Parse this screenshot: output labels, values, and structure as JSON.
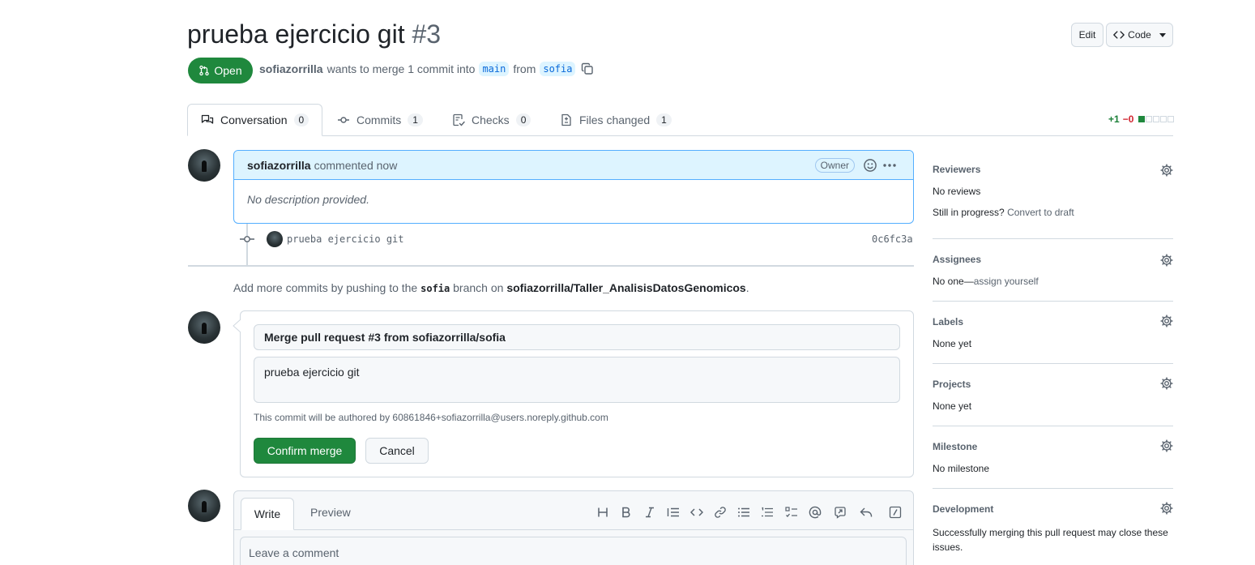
{
  "pr": {
    "title": "prueba ejercicio git",
    "number": "#3",
    "state": "Open",
    "author": "sofiazorrilla",
    "merge_text": "wants to merge 1 commit into",
    "base_branch": "main",
    "from_text": "from",
    "head_branch": "sofia"
  },
  "header_buttons": {
    "edit": "Edit",
    "code": "Code"
  },
  "tabs": [
    {
      "label": "Conversation",
      "count": "0"
    },
    {
      "label": "Commits",
      "count": "1"
    },
    {
      "label": "Checks",
      "count": "0"
    },
    {
      "label": "Files changed",
      "count": "1"
    }
  ],
  "diffstat": {
    "additions": "+1",
    "deletions": "−0"
  },
  "comment": {
    "author": "sofiazorrilla",
    "action": "commented now",
    "badge": "Owner",
    "body": "No description provided."
  },
  "commit": {
    "message": "prueba ejercicio git",
    "sha": "0c6fc3a"
  },
  "hint": {
    "prefix": "Add more commits by pushing to the",
    "branch": "sofia",
    "middle": "branch on",
    "repo": "sofiazorrilla/Taller_AnalisisDatosGenomicos",
    "suffix": "."
  },
  "merge": {
    "title_value": "Merge pull request #3 from sofiazorrilla/sofia",
    "body_value": "prueba ejercicio git",
    "author_note": "This commit will be authored by 60861846+sofiazorrilla@users.noreply.github.com",
    "confirm_label": "Confirm merge",
    "cancel_label": "Cancel"
  },
  "editor": {
    "write_tab": "Write",
    "preview_tab": "Preview",
    "placeholder": "Leave a comment",
    "toolbar": [
      "heading-icon",
      "bold-icon",
      "italic-icon",
      "quote-icon",
      "code-icon",
      "link-icon",
      "unordered-list-icon",
      "ordered-list-icon",
      "task-list-icon",
      "mention-icon",
      "reference-icon",
      "reply-icon",
      "slash-command-icon"
    ]
  },
  "sidebar": {
    "reviewers": {
      "title": "Reviewers",
      "value": "No reviews",
      "progress_text": "Still in progress?",
      "draft_link": "Convert to draft"
    },
    "assignees": {
      "title": "Assignees",
      "value": "No one—",
      "link": "assign yourself"
    },
    "labels": {
      "title": "Labels",
      "value": "None yet"
    },
    "projects": {
      "title": "Projects",
      "value": "None yet"
    },
    "milestone": {
      "title": "Milestone",
      "value": "No milestone"
    },
    "development": {
      "title": "Development",
      "value": "Successfully merging this pull request may close these issues."
    }
  },
  "colors": {
    "green": "#1f883d",
    "blue_bg": "#ddf4ff",
    "blue_border": "#54aeff",
    "muted": "#59636e"
  }
}
